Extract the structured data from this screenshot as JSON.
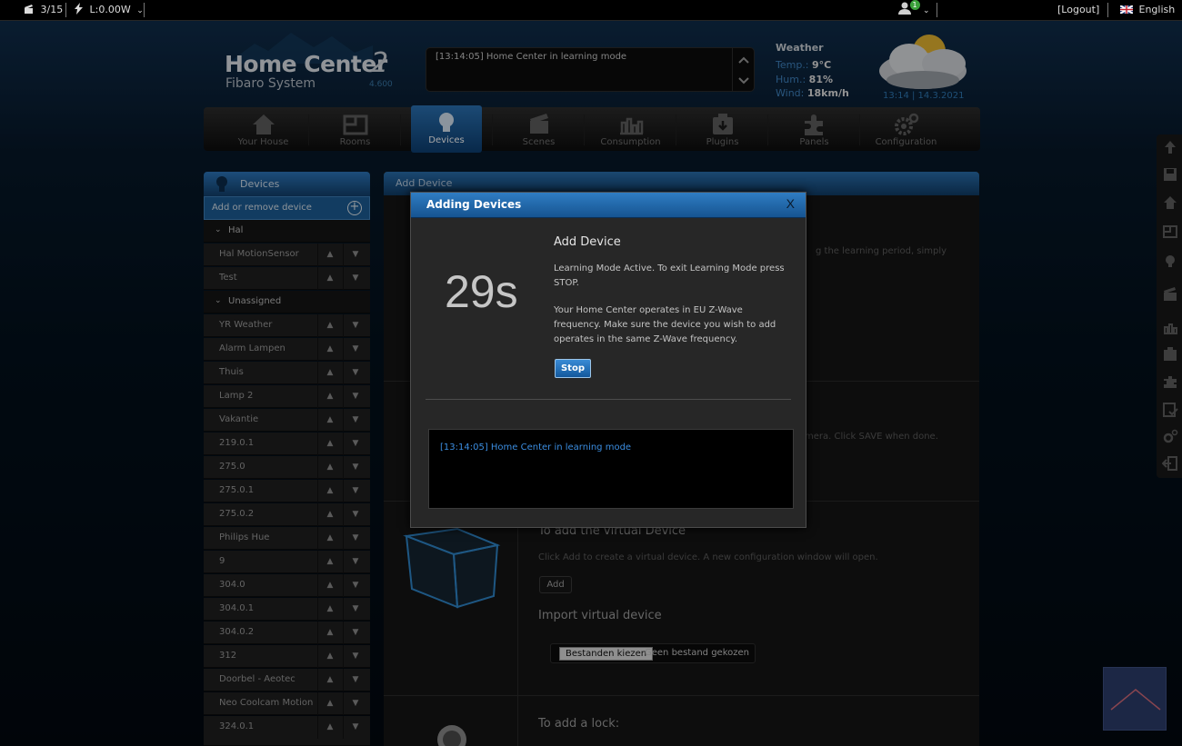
{
  "topbar": {
    "scenes_count": "3/15",
    "power": "L:0.00W",
    "notifications_count": "1",
    "logout": "[Logout]",
    "language": "English"
  },
  "brand": {
    "name": "Home Center",
    "number": "2",
    "subtitle": "Fibaro System",
    "version": "4.600"
  },
  "messages": {
    "latest": "[13:14:05] Home Center in learning mode"
  },
  "weather": {
    "heading": "Weather",
    "temp_label": "Temp.:",
    "temp_value": "9°C",
    "hum_label": "Hum.:",
    "hum_value": "81%",
    "wind_label": "Wind:",
    "wind_value": "18km/h",
    "datetime": "13:14 | 14.3.2021"
  },
  "nav": [
    {
      "label": "Your House",
      "icon": "house-icon"
    },
    {
      "label": "Rooms",
      "icon": "rooms-icon"
    },
    {
      "label": "Devices",
      "icon": "bulb-icon"
    },
    {
      "label": "Scenes",
      "icon": "clapper-icon"
    },
    {
      "label": "Consumption",
      "icon": "chart-icon"
    },
    {
      "label": "Plugins",
      "icon": "plugin-icon"
    },
    {
      "label": "Panels",
      "icon": "puzzle-icon"
    },
    {
      "label": "Configuration",
      "icon": "gears-icon"
    }
  ],
  "sidebar": {
    "title": "Devices",
    "add_remove": "Add or remove device",
    "rooms": [
      {
        "name": "Hal",
        "devices": [
          "Hal MotionSensor",
          "Test"
        ]
      },
      {
        "name": "Unassigned",
        "devices": [
          "YR Weather",
          "Alarm Lampen",
          "Thuis",
          "Lamp 2",
          "Vakantie",
          "219.0.1",
          "275.0",
          "275.0.1",
          "275.0.2",
          "Philips Hue",
          "9",
          "304.0",
          "304.0.1",
          "304.0.2",
          "312",
          "Doorbel - Aeotec",
          "Neo Coolcam Motion",
          "324.0.1"
        ]
      }
    ]
  },
  "panel": {
    "title": "Add Device",
    "section1_text_fragment": "g the learning period, simply",
    "section2_text_fragment": "mera. Click SAVE when done.",
    "virtual_title": "To add the virtual Device",
    "virtual_text": "Click Add to create a virtual device. A new configuration window will open.",
    "add_button": "Add",
    "import_title": "Import virtual device",
    "file_button": "Bestanden kiezen",
    "file_status": "Geen bestand gekozen",
    "lock_title": "To add a lock:"
  },
  "modal": {
    "title": "Adding Devices",
    "close": "X",
    "countdown": "29s",
    "heading": "Add Device",
    "text1": "Learning Mode Active. To exit Learning Mode press STOP.",
    "text2": "Your Home Center operates in EU Z-Wave frequency. Make sure the device you wish to add operates in the same Z-Wave frequency.",
    "stop_button": "Stop",
    "log": "[13:14:05] Home Center in learning mode"
  },
  "colors": {
    "accent": "#2b72b4",
    "log_text": "#3b8de0",
    "weather_label": "#3f83c0"
  }
}
